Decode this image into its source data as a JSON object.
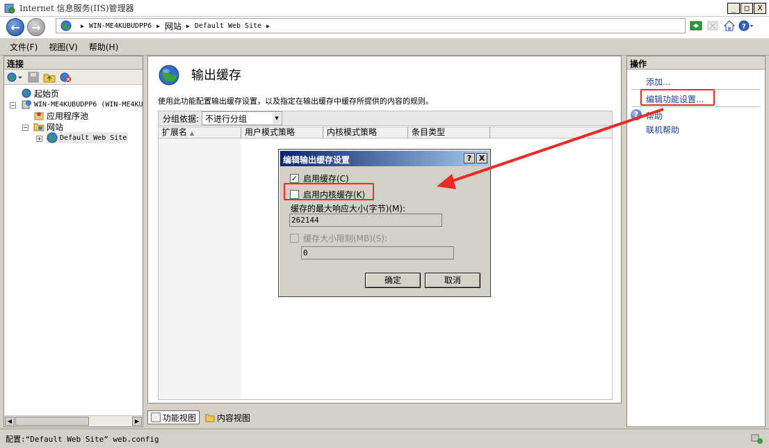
{
  "window": {
    "title": "Internet 信息服务(IIS)管理器",
    "buttons": [
      "_",
      "□",
      "X"
    ]
  },
  "address": {
    "crumbs": [
      "WIN-ME4KUBUDPP6",
      "网站",
      "Default Web Site"
    ]
  },
  "menu": [
    "文件(F)",
    "视图(V)",
    "帮助(H)"
  ],
  "connections": {
    "header": "连接",
    "tree": {
      "start": "起始页",
      "server": "WIN-ME4KUBUDPP6 (WIN-ME4KU",
      "apppools": "应用程序池",
      "sites": "网站",
      "site": "Default Web Site"
    }
  },
  "feature": {
    "title": "输出缓存",
    "description": "使用此功能配置输出缓存设置，以及指定在输出缓存中缓存所提供的内容的规则。",
    "group_label": "分组依据:",
    "group_value": "不进行分组",
    "columns": [
      "扩展名",
      "用户模式策略",
      "内核模式策略",
      "条目类型"
    ]
  },
  "bottom_tabs": [
    "功能视图",
    "内容视图"
  ],
  "actions": {
    "header": "操作",
    "add": "添加...",
    "edit_settings": "编辑功能设置...",
    "help": "帮助",
    "online_help": "联机帮助"
  },
  "status": {
    "text": "配置:“Default Web Site” web.config"
  },
  "dialog": {
    "title": "编辑输出缓存设置",
    "help_btn": "?",
    "close_btn": "X",
    "enable_cache": "启用缓存(C)",
    "enable_cache_checked": true,
    "enable_kernel_cache": "启用内核缓存(K)",
    "enable_kernel_cache_checked": false,
    "max_response_label": "缓存的最大响应大小(字节)(M):",
    "max_response_value": "262144",
    "cache_size_limit": "缓存大小限制(MB)(S):",
    "cache_size_limit_checked": false,
    "cache_size_value": "0",
    "ok": "确定",
    "cancel": "取消"
  },
  "colors": {
    "highlight": "#ee2a24",
    "dialog_title": "#0a246a",
    "link": "#1c3f95"
  }
}
